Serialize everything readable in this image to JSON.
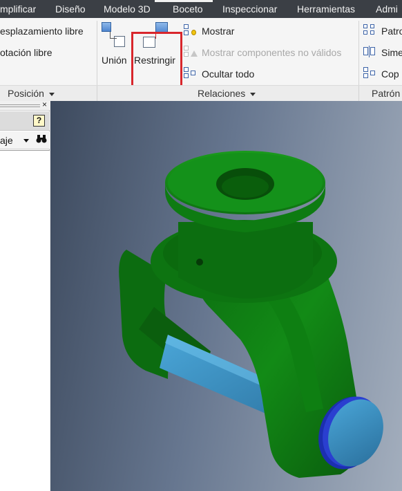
{
  "menu": {
    "tabs": [
      "mplificar",
      "Diseño",
      "Modelo 3D",
      "Boceto",
      "Inspeccionar",
      "Herramientas",
      "Admi"
    ]
  },
  "ribbon": {
    "position_group": {
      "items": [
        "esplazamiento libre",
        "otación libre"
      ],
      "label": "Posición"
    },
    "relations_group": {
      "union_label": "Unión",
      "constrain_label": "Restringir",
      "show_label": "Mostrar",
      "show_invalid_label": "Mostrar componentes no válidos",
      "hide_all_label": "Ocultar todo",
      "label": "Relaciones"
    },
    "pattern_group": {
      "items": [
        "Patro",
        "Sime",
        "Cop"
      ],
      "label": "Patrón"
    }
  },
  "browser_panel": {
    "close_glyph": "×",
    "help_glyph": "?",
    "view_label": "aje"
  },
  "colors": {
    "model_green": "#0f7a12",
    "pin_blue": "#3d8ec2",
    "highlight_red": "#d8262c"
  }
}
